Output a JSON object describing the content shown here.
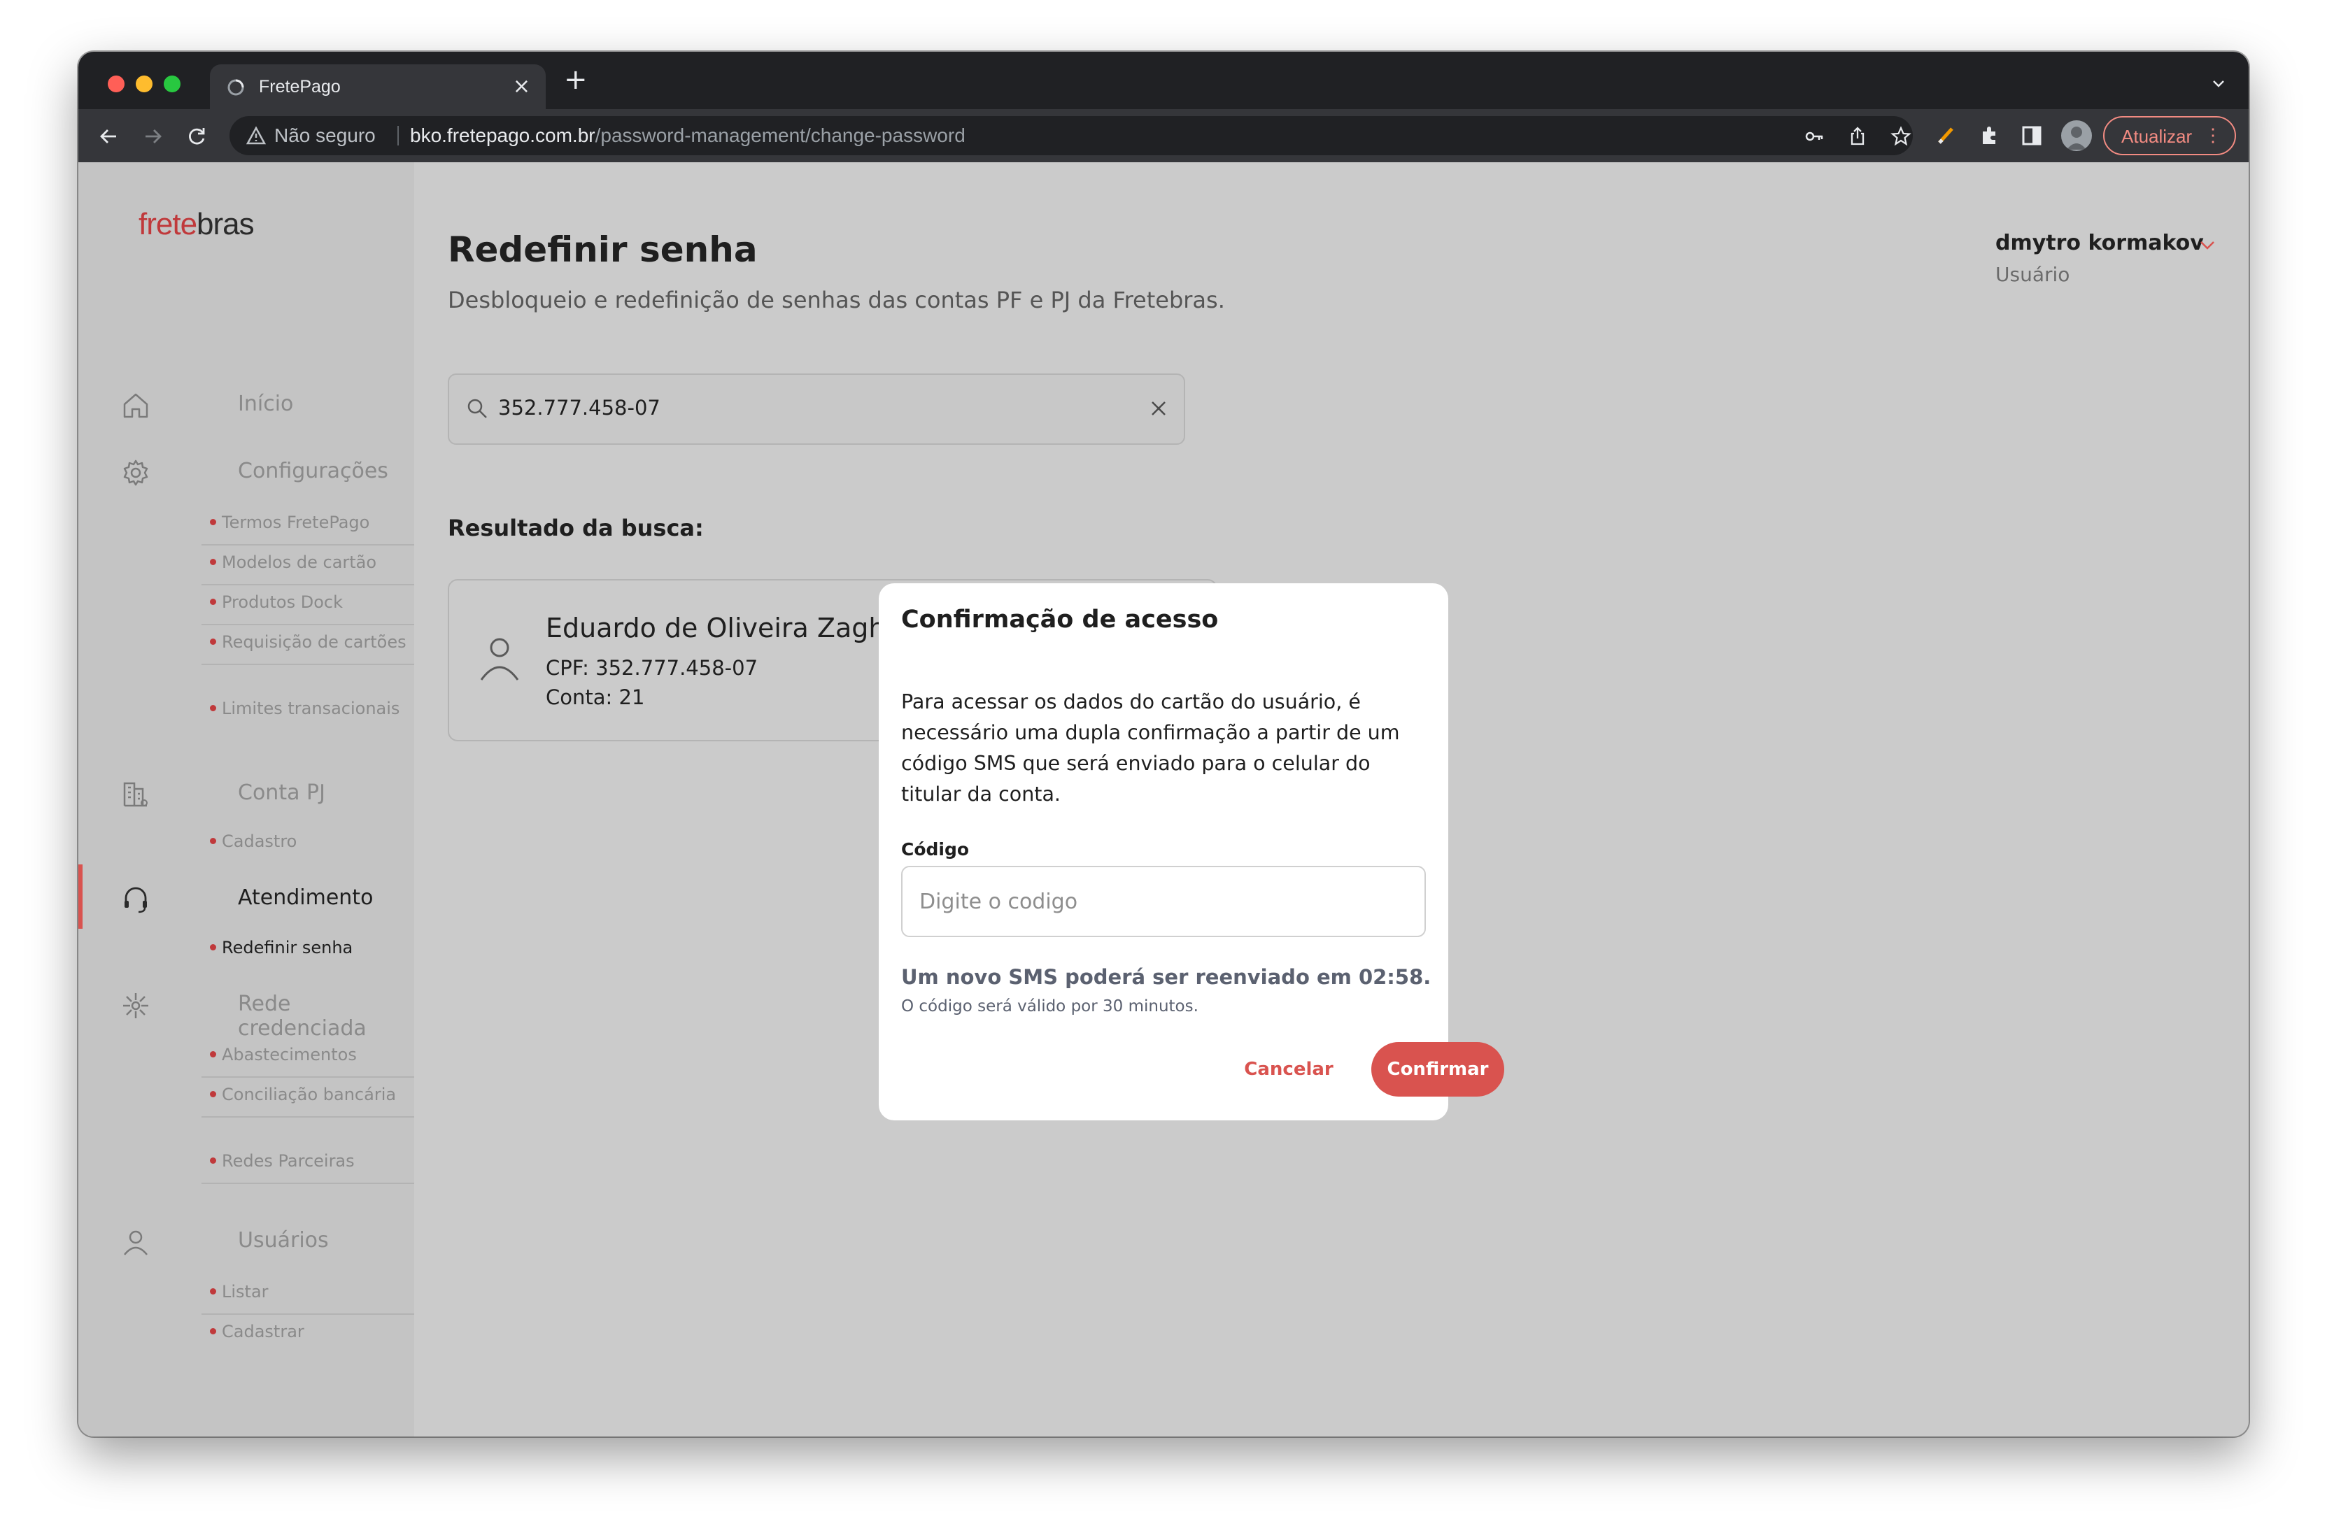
{
  "browser": {
    "tab_title": "FretePago",
    "security_label": "Não seguro",
    "url_host": "bko.fretepago.com.br",
    "url_path": "/password-management/change-password",
    "update_label": "Atualizar"
  },
  "brand": {
    "logo_part1": "frete",
    "logo_part2": "bras",
    "accent": "#d9534f"
  },
  "sidebar": {
    "groups": [
      {
        "label": "Início",
        "icon": "home-icon"
      },
      {
        "label": "Configurações",
        "icon": "gear-icon",
        "items": [
          "Termos FretePago",
          "Modelos de cartão",
          "Produtos Dock",
          "Requisição de cartões",
          "Limites transacionais"
        ]
      },
      {
        "label": "Conta PJ",
        "icon": "building-icon",
        "items": [
          "Cadastro"
        ]
      },
      {
        "label": "Atendimento",
        "icon": "headset-icon",
        "active": true,
        "items": [
          "Redefinir senha"
        ]
      },
      {
        "label": "Rede credenciada",
        "icon": "network-icon",
        "items": [
          "Abastecimentos",
          "Conciliação bancária",
          "Redes Parceiras"
        ]
      },
      {
        "label": "Usuários",
        "icon": "user-icon",
        "items": [
          "Listar",
          "Cadastrar"
        ]
      }
    ]
  },
  "header": {
    "title": "Redefinir senha",
    "subtitle": "Desbloqueio e redefinição de senhas das contas PF e PJ da Fretebras.",
    "user_name": "dmytro kormakov",
    "user_role": "Usuário"
  },
  "search": {
    "value": "352.777.458-07"
  },
  "results": {
    "title": "Resultado da busca:",
    "card": {
      "name": "Eduardo de Oliveira Zaghi",
      "cpf": "CPF: 352.777.458-07",
      "account": "Conta: 21"
    }
  },
  "modal": {
    "title": "Confirmação de acesso",
    "body": "Para acessar os dados do cartão do usuário, é necessário uma dupla confirmação a partir de um código SMS que será enviado para o celular do titular da conta.",
    "code_label": "Código",
    "code_placeholder": "Digite o codigo",
    "resend_text": "Um novo SMS poderá ser reenviado em 02:58.",
    "valid_text": "O código será válido por 30 minutos.",
    "cancel_label": "Cancelar",
    "confirm_label": "Confirmar"
  }
}
